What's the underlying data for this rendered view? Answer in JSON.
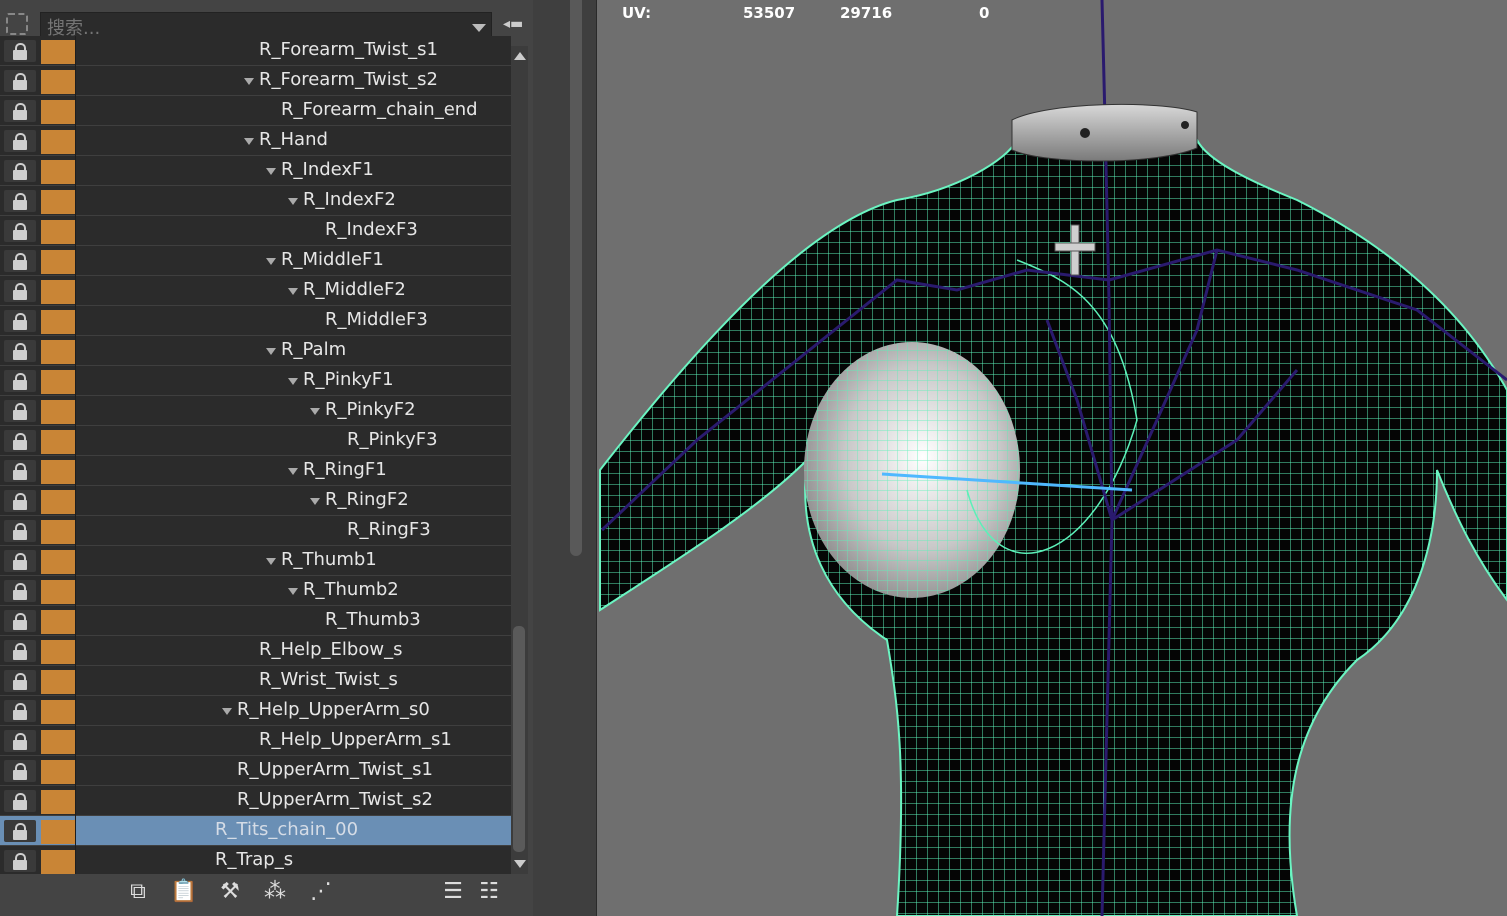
{
  "outliner": {
    "search": {
      "placeholder": "搜索..."
    },
    "rows": [
      {
        "label": "R_Forearm_Twist_s1",
        "indent": 3,
        "expanded": false,
        "selected": false
      },
      {
        "label": "R_Forearm_Twist_s2",
        "indent": 3,
        "expanded": true,
        "selected": false
      },
      {
        "label": "R_Forearm_chain_end",
        "indent": 4,
        "expanded": false,
        "selected": false
      },
      {
        "label": "R_Hand",
        "indent": 3,
        "expanded": true,
        "selected": false
      },
      {
        "label": "R_IndexF1",
        "indent": 4,
        "expanded": true,
        "selected": false
      },
      {
        "label": "R_IndexF2",
        "indent": 5,
        "expanded": true,
        "selected": false
      },
      {
        "label": "R_IndexF3",
        "indent": 6,
        "expanded": false,
        "selected": false
      },
      {
        "label": "R_MiddleF1",
        "indent": 4,
        "expanded": true,
        "selected": false
      },
      {
        "label": "R_MiddleF2",
        "indent": 5,
        "expanded": true,
        "selected": false
      },
      {
        "label": "R_MiddleF3",
        "indent": 6,
        "expanded": false,
        "selected": false
      },
      {
        "label": "R_Palm",
        "indent": 4,
        "expanded": true,
        "selected": false
      },
      {
        "label": "R_PinkyF1",
        "indent": 5,
        "expanded": true,
        "selected": false
      },
      {
        "label": "R_PinkyF2",
        "indent": 6,
        "expanded": true,
        "selected": false
      },
      {
        "label": "R_PinkyF3",
        "indent": 7,
        "expanded": false,
        "selected": false
      },
      {
        "label": "R_RingF1",
        "indent": 5,
        "expanded": true,
        "selected": false
      },
      {
        "label": "R_RingF2",
        "indent": 6,
        "expanded": true,
        "selected": false
      },
      {
        "label": "R_RingF3",
        "indent": 7,
        "expanded": false,
        "selected": false
      },
      {
        "label": "R_Thumb1",
        "indent": 4,
        "expanded": true,
        "selected": false
      },
      {
        "label": "R_Thumb2",
        "indent": 5,
        "expanded": true,
        "selected": false
      },
      {
        "label": "R_Thumb3",
        "indent": 6,
        "expanded": false,
        "selected": false
      },
      {
        "label": "R_Help_Elbow_s",
        "indent": 3,
        "expanded": false,
        "selected": false
      },
      {
        "label": "R_Wrist_Twist_s",
        "indent": 3,
        "expanded": false,
        "selected": false
      },
      {
        "label": "R_Help_UpperArm_s0",
        "indent": 2,
        "expanded": true,
        "selected": false
      },
      {
        "label": "R_Help_UpperArm_s1",
        "indent": 3,
        "expanded": false,
        "selected": false
      },
      {
        "label": "R_UpperArm_Twist_s1",
        "indent": 2,
        "expanded": false,
        "selected": false
      },
      {
        "label": "R_UpperArm_Twist_s2",
        "indent": 2,
        "expanded": false,
        "selected": false
      },
      {
        "label": "R_Tits_chain_00",
        "indent": 1,
        "expanded": false,
        "selected": true
      },
      {
        "label": "R_Trap_s",
        "indent": 1,
        "expanded": false,
        "selected": false
      }
    ],
    "toolbar_icons": [
      "copy-icon",
      "paste-icon",
      "hammer-icon",
      "hierarchy-icon",
      "node-graph-icon",
      "collapse-list-icon",
      "expand-list-icon"
    ]
  },
  "viewport": {
    "hud": {
      "label": "UV:",
      "v1": "53507",
      "v2": "29716",
      "v3": "0"
    }
  },
  "colors": {
    "joint_swatch": "#c98536",
    "selection": "#6a8fb5",
    "wireframe": "#5cf0b8",
    "skeleton": "#2a1a6e"
  }
}
